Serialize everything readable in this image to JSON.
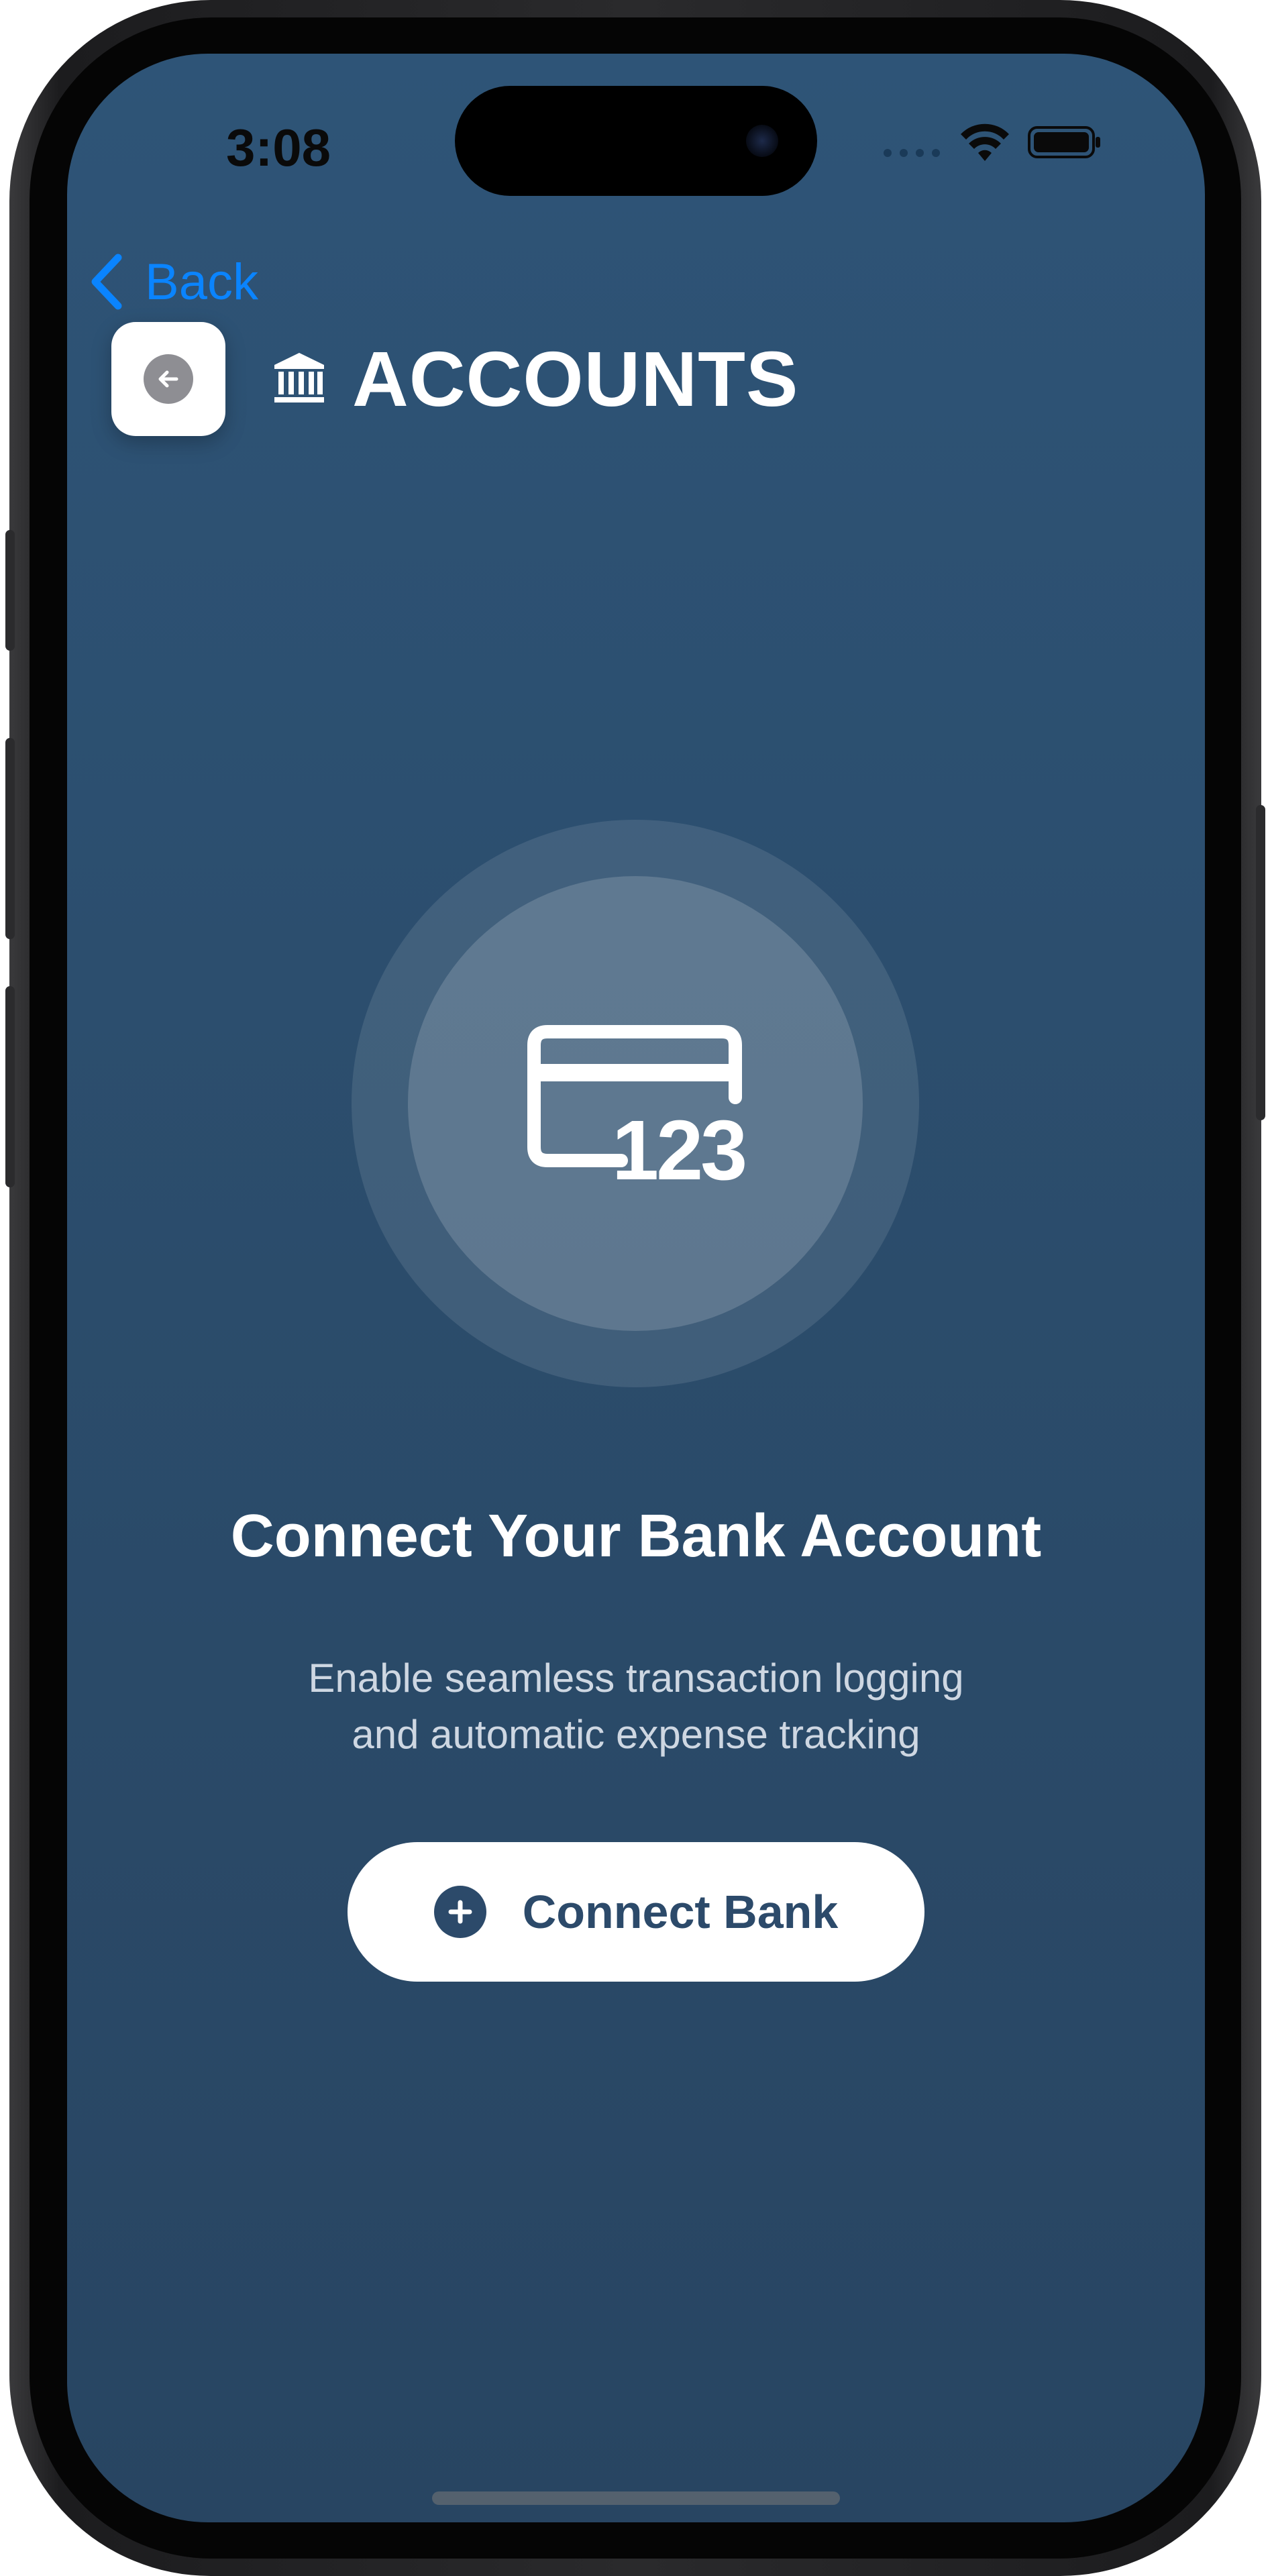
{
  "status_bar": {
    "time": "3:08"
  },
  "nav": {
    "back_label": "Back"
  },
  "header": {
    "title": "ACCOUNTS"
  },
  "hero": {
    "card_digits": "123"
  },
  "content": {
    "title": "Connect Your Bank Account",
    "subtitle_line1": "Enable seamless transaction logging",
    "subtitle_line2": "and automatic expense tracking"
  },
  "actions": {
    "connect_label": "Connect Bank"
  },
  "colors": {
    "background_top": "#2e5477",
    "background_bottom": "#284562",
    "accent_blue": "#0a84ff",
    "button_text": "#2c4a6a"
  },
  "icons": {
    "back_chevron": "chevron-left-icon",
    "back_tile": "arrow-left-circle-icon",
    "bank": "bank-building-icon",
    "card": "credit-card-icon",
    "plus": "plus-circle-icon"
  }
}
